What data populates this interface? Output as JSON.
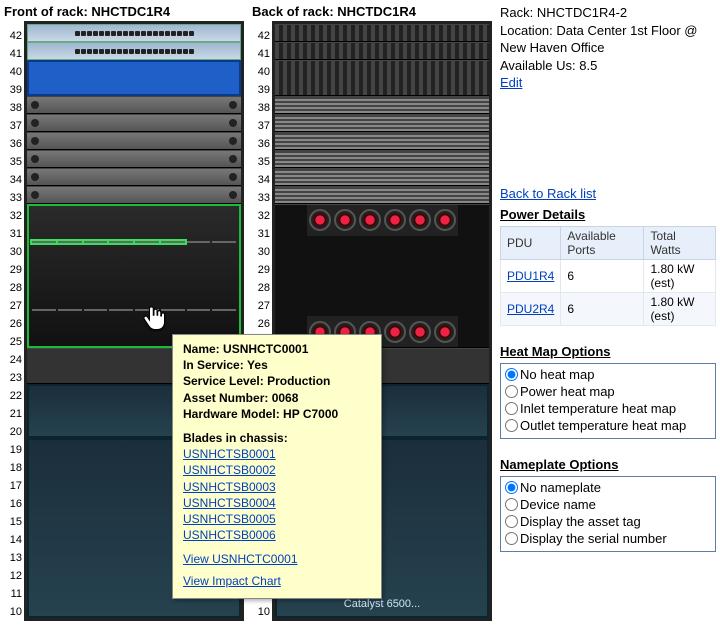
{
  "front": {
    "title": "Front of rack: NHCTDC1R4"
  },
  "back": {
    "title": "Back of rack: NHCTDC1R4"
  },
  "u_labels": [
    10,
    11,
    12,
    13,
    14,
    15,
    16,
    17,
    18,
    19,
    20,
    21,
    22,
    23,
    24,
    25,
    26,
    27,
    28,
    29,
    30,
    31,
    32,
    33,
    34,
    35,
    36,
    37,
    38,
    39,
    40,
    41,
    42
  ],
  "tooltip": {
    "name_label": "Name:",
    "name": "USNHCTC0001",
    "in_service_label": "In Service:",
    "in_service": "Yes",
    "service_level_label": "Service Level:",
    "service_level": "Production",
    "asset_label": "Asset Number:",
    "asset": "0068",
    "hw_label": "Hardware Model:",
    "hw": "HP C7000",
    "blades_label": "Blades in chassis:",
    "blades": [
      "USNHCTSB0001",
      "USNHCTSB0002",
      "USNHCTSB0003",
      "USNHCTSB0004",
      "USNHCTSB0005",
      "USNHCTSB0006"
    ],
    "view_device": "View USNHCTC0001",
    "view_impact": "View Impact Chart"
  },
  "back_label": "Catalyst 6500...",
  "side": {
    "rack_label": "Rack:",
    "rack": "NHCTDC1R4-2",
    "loc_label": "Location:",
    "loc": "Data Center 1st Floor @ New Haven Office",
    "avail_label": "Available Us:",
    "avail": "8.5",
    "edit": "Edit",
    "back_link": "Back to Rack list",
    "power_h": "Power Details",
    "power_cols": {
      "c1": "PDU",
      "c2": "Available Ports",
      "c3": "Total Watts"
    },
    "pdus": [
      {
        "name": "PDU1R4",
        "ports": "6",
        "watts": "1.80 kW (est)"
      },
      {
        "name": "PDU2R4",
        "ports": "6",
        "watts": "1.80 kW (est)"
      }
    ],
    "heat_h": "Heat Map Options",
    "heat_opts": [
      "No heat map",
      "Power heat map",
      "Inlet temperature heat map",
      "Outlet temperature heat map"
    ],
    "name_h": "Nameplate Options",
    "name_opts": [
      "No nameplate",
      "Device name",
      "Display the asset tag",
      "Display the serial number"
    ]
  }
}
